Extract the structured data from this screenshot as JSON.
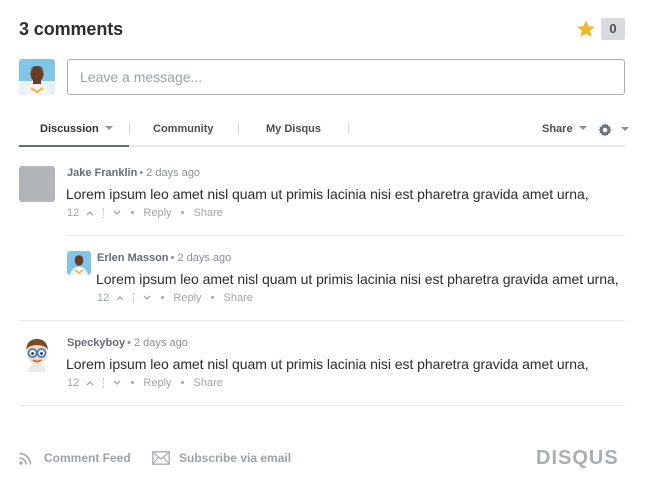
{
  "header": {
    "comment_count_label": "3 comments",
    "recommend_count": "0",
    "star_color": "#f0b628"
  },
  "composer": {
    "placeholder": "Leave a message..."
  },
  "nav": {
    "tabs": [
      {
        "label": "Discussion",
        "active": true
      },
      {
        "label": "Community"
      },
      {
        "label": "My Disqus"
      }
    ],
    "share_label": "Share"
  },
  "posts": [
    {
      "author": "Jake Franklin",
      "meta": "• 2 days ago",
      "body": "Lorem ipsum leo amet nisl quam ut primis lacinia nisi est pharetra gravida amet urna,",
      "votes": "12",
      "reply_label": "Reply",
      "share_label": "Share",
      "avatar": "grey-placeholder-avatar"
    },
    {
      "author": "Erlen Masson",
      "meta": "• 2 days ago",
      "body": "Lorem ipsum leo amet nisl quam ut primis lacinia nisi est pharetra gravida amet urna,",
      "votes": "12",
      "reply_label": "Reply",
      "share_label": "Share",
      "avatar": "illustrated-man-avatar"
    },
    {
      "author": "Speckyboy",
      "meta": "• 2 days ago",
      "body": "Lorem ipsum leo amet nisl quam ut primis lacinia nisi est pharetra gravida amet urna,",
      "votes": "12",
      "reply_label": "Reply",
      "share_label": "Share",
      "avatar": "glasses-boy-avatar"
    }
  ],
  "footer": {
    "feed_label": "Comment Feed",
    "subscribe_label": "Subscribe via email",
    "brand": "DISQUS"
  }
}
